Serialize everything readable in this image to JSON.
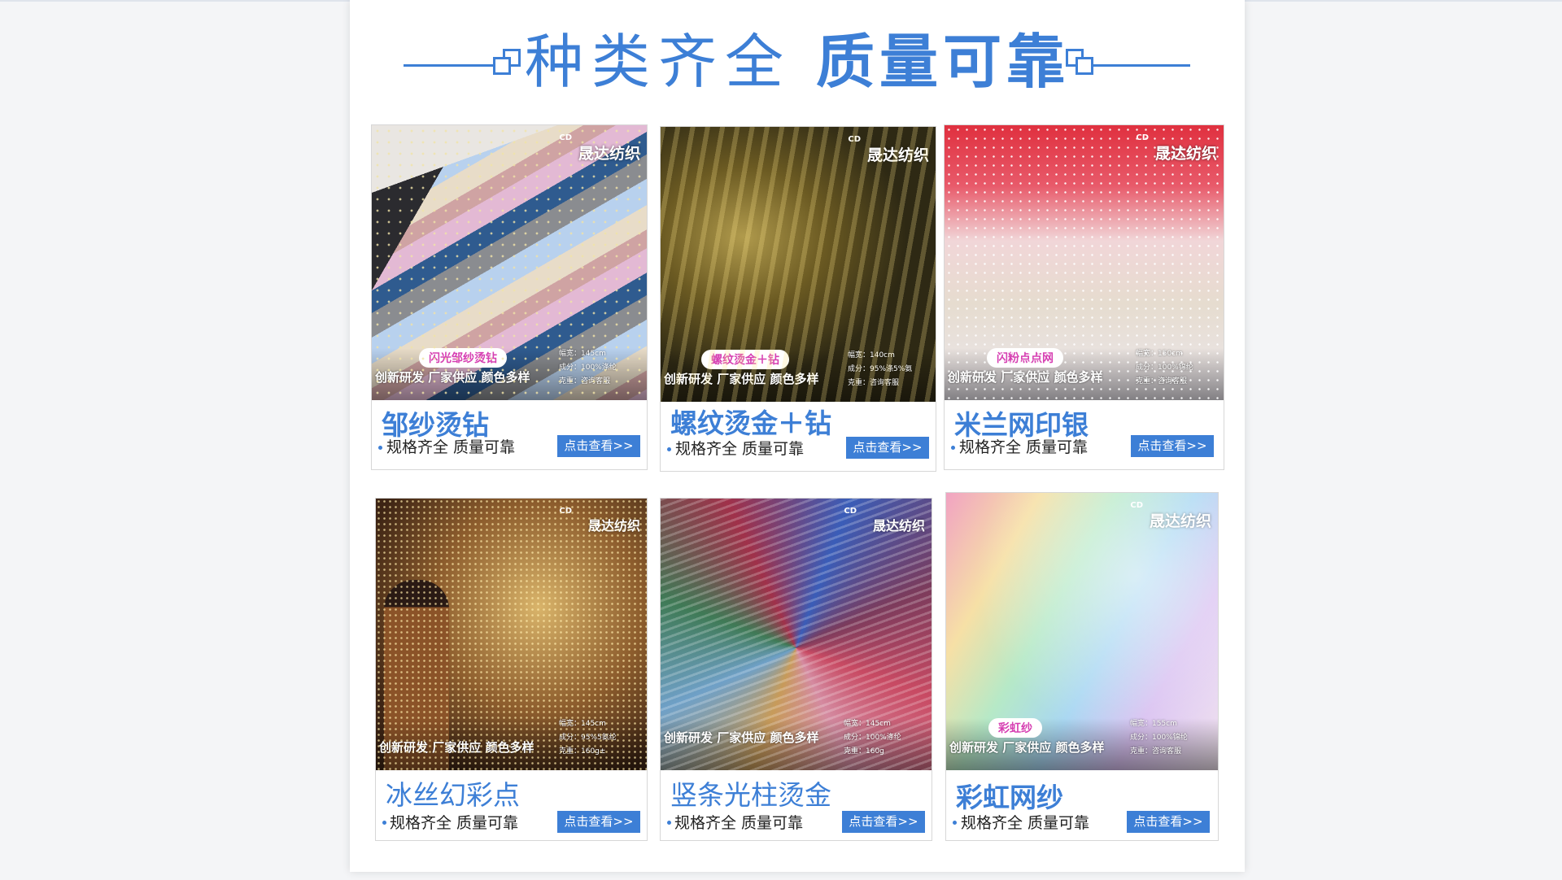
{
  "header": {
    "title_light": "种类齐全",
    "title_bold": "质量可靠"
  },
  "theme": {
    "accent": "#3d7fd6",
    "pill_text": "#d63fb2"
  },
  "products": [
    {
      "brand": "晟达纺织",
      "brand_mark": "CD",
      "tag": "闪光邹纱烫钻",
      "slogan": "创新研发 厂家供应 颜色多样",
      "specs": [
        "幅宽：145cm",
        "成分：100%涤纶",
        "克重：咨询客服"
      ],
      "name": "邹纱烫钻",
      "subtitle": "规格齐全 质量可靠",
      "button": "点击查看>>"
    },
    {
      "brand": "晟达纺织",
      "brand_mark": "CD",
      "tag": "螺纹烫金＋钻",
      "slogan": "创新研发 厂家供应 颜色多样",
      "specs": [
        "幅宽：140cm",
        "成分：95%涤5%氨",
        "克重：咨询客服"
      ],
      "name": "螺纹烫金＋钻",
      "subtitle": "规格齐全 质量可靠",
      "button": "点击查看>>"
    },
    {
      "brand": "晟达纺织",
      "brand_mark": "CD",
      "tag": "闪粉点点网",
      "slogan": "创新研发 厂家供应 颜色多样",
      "specs": [
        "幅宽：150cm",
        "成分：100%锦纶",
        "克重：咨询客服"
      ],
      "name": "米兰网印银",
      "subtitle": "规格齐全 质量可靠",
      "button": "点击查看>>"
    },
    {
      "brand": "晟达纺织",
      "brand_mark": "CD",
      "tag": "",
      "slogan": "创新研发 厂家供应 颜色多样",
      "specs": [
        "幅宽：145cm",
        "成分：95%5氨纶",
        "克重：160g±"
      ],
      "name": "冰丝幻彩点",
      "subtitle": "规格齐全 质量可靠",
      "button": "点击查看>>"
    },
    {
      "brand": "晟达纺织",
      "brand_mark": "CD",
      "tag": "",
      "slogan": "创新研发 厂家供应 颜色多样",
      "specs": [
        "幅宽：145cm",
        "成分：100%涤纶",
        "克重：160g"
      ],
      "name": "竖条光柱烫金",
      "subtitle": "规格齐全 质量可靠",
      "button": "点击查看>>"
    },
    {
      "brand": "晟达纺织",
      "brand_mark": "CD",
      "tag": "彩虹纱",
      "slogan": "创新研发 厂家供应 颜色多样",
      "specs": [
        "幅宽：155cm",
        "成分：100%锦纶",
        "克重：咨询客服"
      ],
      "name": "彩虹网纱",
      "subtitle": "规格齐全 质量可靠",
      "button": "点击查看>>"
    }
  ]
}
